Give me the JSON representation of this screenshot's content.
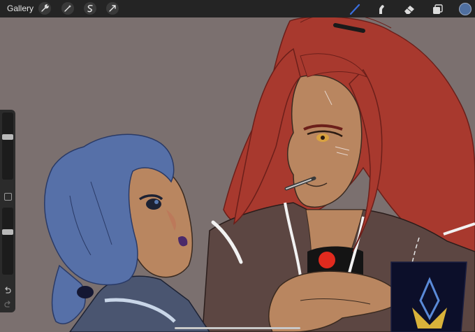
{
  "toolbar": {
    "gallery_label": "Gallery",
    "left_tools": [
      {
        "name": "wrench-icon"
      },
      {
        "name": "magic-wand-icon"
      },
      {
        "name": "selection-icon"
      },
      {
        "name": "transform-icon"
      }
    ],
    "right_tools": [
      {
        "name": "brush-icon",
        "active": true
      },
      {
        "name": "smudge-icon",
        "active": false
      },
      {
        "name": "eraser-icon",
        "active": false
      },
      {
        "name": "layers-icon",
        "active": false
      }
    ],
    "current_color": "#4f6fa0",
    "active_tool_color": "#3b6fe0"
  },
  "sidebar": {
    "brush_size_level": 0.35,
    "opacity_level": 0.35,
    "icons": [
      "modify-button-icon",
      "undo-icon",
      "redo-icon"
    ]
  },
  "colors": {
    "background": "#7b706f",
    "blue_hair": "#5670a8",
    "red_hair": "#a8392e",
    "skin": "#b98660",
    "jacket": "#5c4642",
    "dark_panel": "#0c0f2a",
    "emblem": "#d9b23a"
  }
}
